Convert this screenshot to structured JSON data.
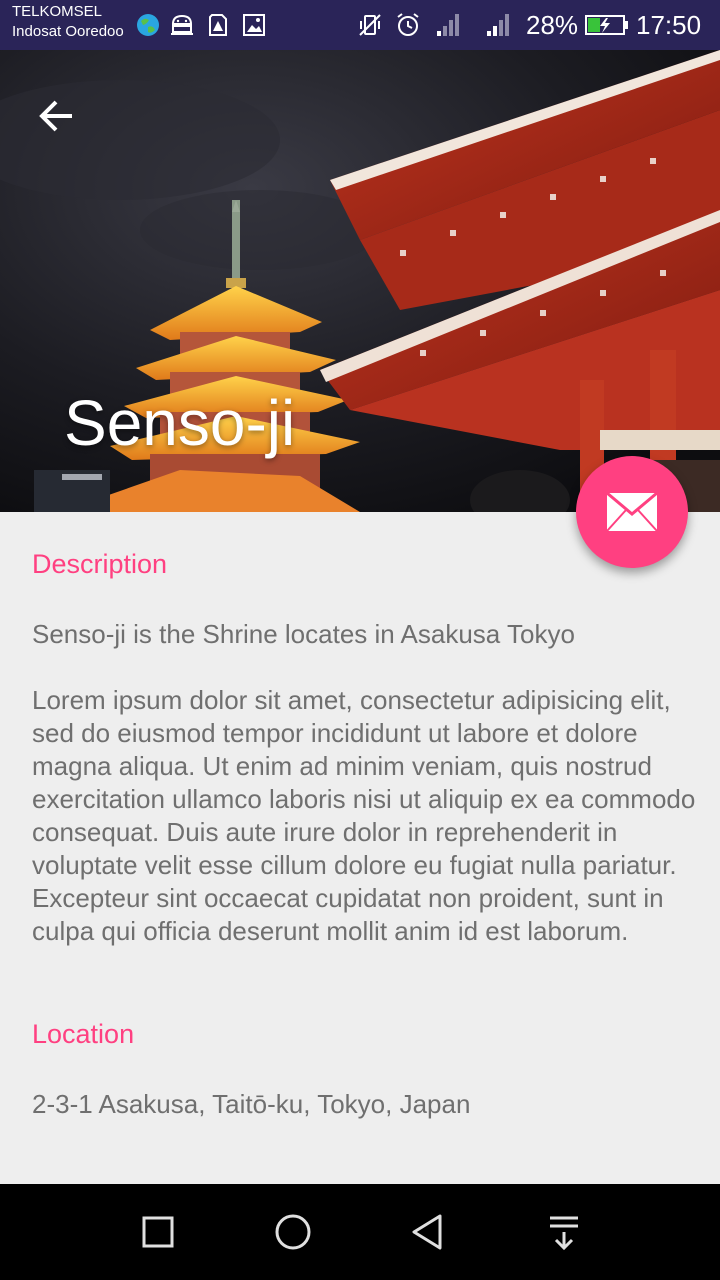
{
  "status_bar": {
    "carrier_primary": "TELKOMSEL",
    "carrier_secondary": "Indosat Ooredoo",
    "battery_percent": "28%",
    "time": "17:50",
    "icons": [
      "globe-icon",
      "android-icon",
      "sim-alert-icon",
      "image-icon",
      "vibrate-off-icon",
      "alarm-icon",
      "signal-icon",
      "signal-icon",
      "battery-charging-icon"
    ]
  },
  "header": {
    "title": "Senso-ji",
    "back_icon": "arrow-back-icon"
  },
  "fab": {
    "icon": "email-icon",
    "color": "#ff4081"
  },
  "content": {
    "description_heading": "Description",
    "description_intro": "Senso-ji is the Shrine locates in Asakusa Tokyo",
    "description_body": "Lorem ipsum dolor sit amet, consectetur adipisicing elit, sed do eiusmod tempor incididunt ut labore et dolore magna aliqua. Ut enim ad minim veniam, quis nostrud exercitation ullamco laboris nisi ut aliquip ex ea commodo consequat. Duis aute irure dolor in reprehenderit in voluptate velit esse cillum dolore eu fugiat nulla pariatur. Excepteur sint occaecat cupidatat non proident, sunt in culpa qui officia deserunt mollit anim id est laborum.",
    "location_heading": "Location",
    "location_address": "2-3-1 Asakusa, Taitō-ku, Tokyo, Japan"
  },
  "nav_bar": {
    "icons": [
      "recent-apps-icon",
      "home-icon",
      "back-icon",
      "notifications-pull-icon"
    ]
  },
  "colors": {
    "accent": "#ff4081",
    "status_bar": "#2a2458",
    "body_text": "#6f6f6f",
    "background": "#eeeeee"
  }
}
